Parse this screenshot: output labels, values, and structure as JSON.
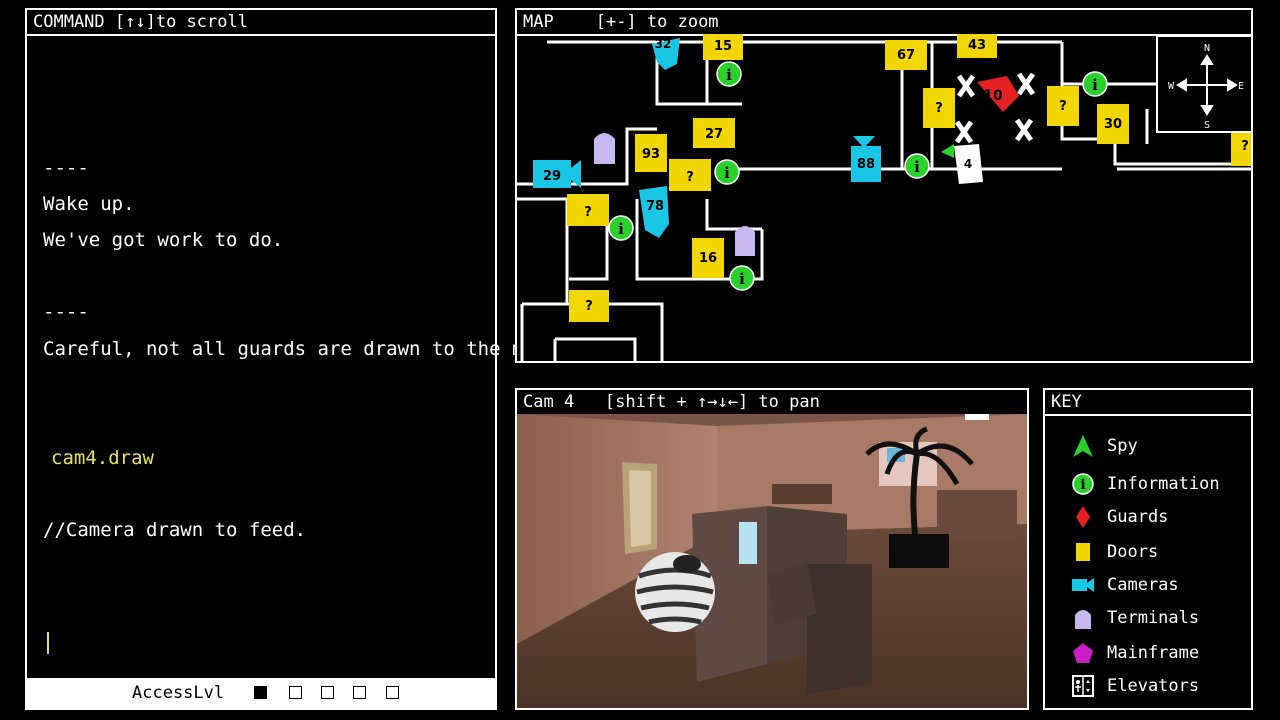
{
  "command": {
    "header": "COMMAND",
    "header_hint": "[↑↓]to scroll",
    "lines": [
      {
        "text": "----",
        "color": "white"
      },
      {
        "text": "Wake up.",
        "color": "white"
      },
      {
        "text": "We've got work to do.",
        "color": "white"
      },
      {
        "text": "----",
        "color": "white"
      },
      {
        "text": "Careful, not all guards are drawn to the map.",
        "color": "white"
      },
      {
        "text": "cam4.draw",
        "color": "yellow"
      },
      {
        "text": "//Camera drawn to feed.",
        "color": "white"
      }
    ],
    "access_label": "AccessLvl",
    "access_level": 1,
    "access_max": 5
  },
  "map": {
    "header": "MAP",
    "header_hint": "[+-] to zoom",
    "compass": {
      "n": "N",
      "s": "S",
      "e": "E",
      "w": "W"
    },
    "doors": [
      {
        "label": "15"
      },
      {
        "label": "67"
      },
      {
        "label": "43"
      },
      {
        "label": "93"
      },
      {
        "label": "27"
      },
      {
        "label": "?"
      },
      {
        "label": "?"
      },
      {
        "label": "?"
      },
      {
        "label": "16"
      },
      {
        "label": "?"
      },
      {
        "label": "?"
      },
      {
        "label": "?"
      },
      {
        "label": "30"
      }
    ],
    "cameras": [
      {
        "label": "32"
      },
      {
        "label": "29"
      },
      {
        "label": "78"
      },
      {
        "label": "88"
      }
    ],
    "guard": {
      "label": "10"
    },
    "elevator": {
      "label": "4"
    },
    "colors": {
      "door": "#f2d600",
      "camera": "#19c6e6",
      "info": "#2ad12a",
      "guard": "#e52020",
      "terminal": "#c8b8f0"
    }
  },
  "camera": {
    "header": "Cam 4",
    "header_hint": "[shift + ↑→↓←] to pan"
  },
  "key": {
    "header": "KEY",
    "items": [
      {
        "label": "Spy",
        "icon": "spy-arrow-icon"
      },
      {
        "label": "Information",
        "icon": "info-icon"
      },
      {
        "label": "Guards",
        "icon": "guard-diamond-icon"
      },
      {
        "label": "Doors",
        "icon": "door-icon"
      },
      {
        "label": "Cameras",
        "icon": "camera-icon"
      },
      {
        "label": "Terminals",
        "icon": "terminal-icon"
      },
      {
        "label": "Mainframe",
        "icon": "mainframe-pentagon-icon"
      },
      {
        "label": "Elevators",
        "icon": "elevator-icon"
      }
    ]
  }
}
